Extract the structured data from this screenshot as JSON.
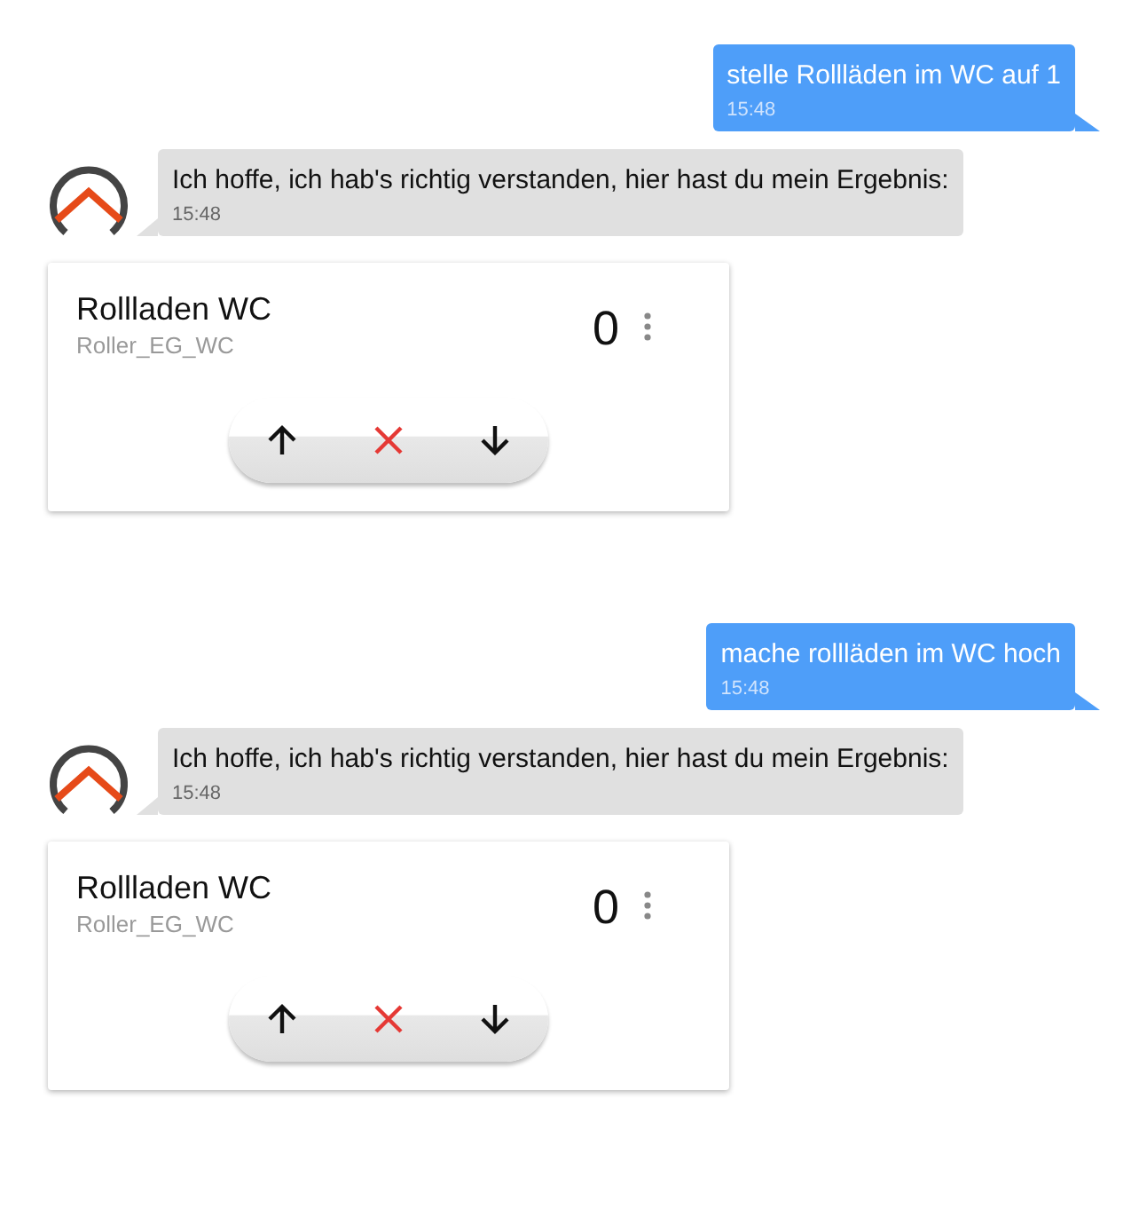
{
  "messages": [
    {
      "kind": "user",
      "text": "stelle Rollläden im WC auf 1",
      "time": "15:48"
    },
    {
      "kind": "bot",
      "text": "Ich hoffe, ich hab's richtig verstanden, hier hast du mein Ergebnis:",
      "time": "15:48"
    },
    {
      "kind": "card",
      "title": "Rollladen WC",
      "subtitle": "Roller_EG_WC",
      "value": "0"
    },
    {
      "kind": "user",
      "text": "mache rollläden im WC hoch",
      "time": "15:48"
    },
    {
      "kind": "bot",
      "text": "Ich hoffe, ich hab's richtig verstanden, hier hast du mein Ergebnis:",
      "time": "15:48"
    },
    {
      "kind": "card",
      "title": "Rollladen WC",
      "subtitle": "Roller_EG_WC",
      "value": "0"
    }
  ]
}
